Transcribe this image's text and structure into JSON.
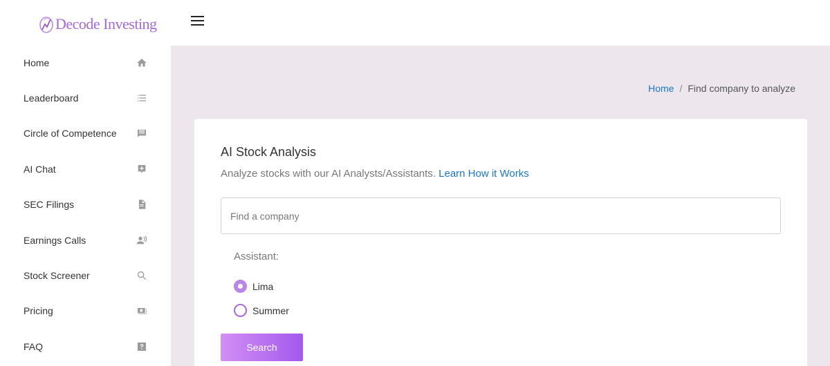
{
  "brand": {
    "name": "Decode Investing",
    "color": "#a56ad9"
  },
  "sidebar": {
    "items": [
      {
        "label": "Home",
        "icon": "home-icon"
      },
      {
        "label": "Leaderboard",
        "icon": "list-icon"
      },
      {
        "label": "Circle of Competence",
        "icon": "message-icon"
      },
      {
        "label": "AI Chat",
        "icon": "add-chat-icon"
      },
      {
        "label": "SEC Filings",
        "icon": "document-icon"
      },
      {
        "label": "Earnings Calls",
        "icon": "speaker-person-icon"
      },
      {
        "label": "Stock Screener",
        "icon": "search-icon"
      },
      {
        "label": "Pricing",
        "icon": "money-icon"
      },
      {
        "label": "FAQ",
        "icon": "question-icon"
      }
    ]
  },
  "topbar": {
    "menu_icon": "hamburger-icon"
  },
  "breadcrumb": {
    "home": "Home",
    "separator": "/",
    "current": "Find company to analyze"
  },
  "card": {
    "title": "AI Stock Analysis",
    "subtitle": "Analyze stocks with our AI Analysts/Assistants.",
    "learn_link": "Learn How it Works",
    "search_placeholder": "Find a company",
    "search_value": "",
    "assistant_label": "Assistant:",
    "options": [
      {
        "label": "Lima",
        "selected": true
      },
      {
        "label": "Summer",
        "selected": false
      }
    ],
    "search_button": "Search"
  },
  "colors": {
    "accent": "#a56ad9",
    "link": "#1a76c7",
    "main_bg": "#ede6ed"
  }
}
